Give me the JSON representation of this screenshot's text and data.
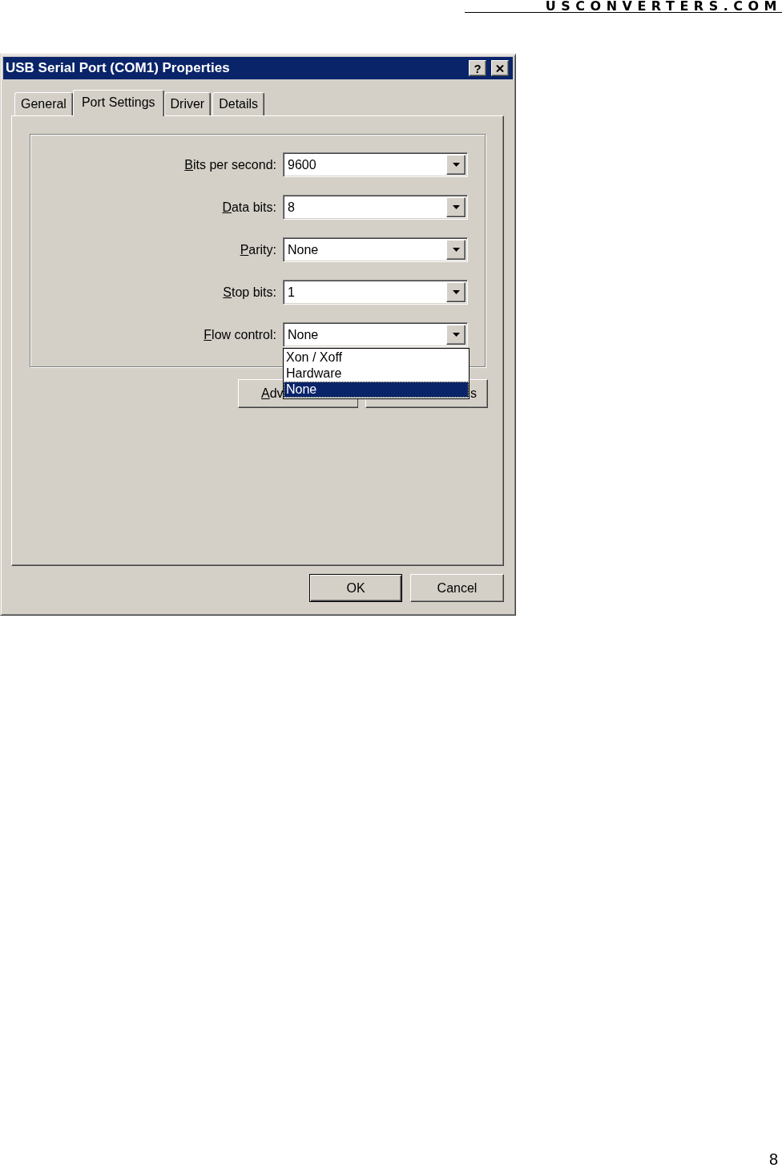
{
  "page_header": {
    "logo": "USCONVERTERS.COM"
  },
  "window": {
    "title": "USB Serial Port (COM1) Properties",
    "title_buttons": [
      {
        "kind": "help",
        "label": "?"
      },
      {
        "kind": "close"
      }
    ]
  },
  "tabs": [
    {
      "label": "General",
      "selected": false
    },
    {
      "label": "Port Settings",
      "selected": true
    },
    {
      "label": "Driver",
      "selected": false
    },
    {
      "label": "Details",
      "selected": false
    }
  ],
  "settings": [
    {
      "label": "Bits per second:",
      "value": "9600"
    },
    {
      "label": "Data bits:",
      "value": "8"
    },
    {
      "label": "Parity:",
      "value": "None"
    },
    {
      "label": "Stop bits:",
      "value": "1"
    },
    {
      "label": "Flow control:",
      "value": "None",
      "options": [
        {
          "label": "Xon / Xoff",
          "selected": false
        },
        {
          "label": "Hardware",
          "selected": false
        },
        {
          "label": "None",
          "selected": true
        }
      ]
    }
  ],
  "panel_buttons": [
    {
      "label": "Adv",
      "kind": "head"
    },
    {
      "label": "s",
      "kind": "tail"
    }
  ],
  "dialog_buttons": [
    {
      "label": "OK",
      "default": true
    },
    {
      "label": "Cancel",
      "default": false
    }
  ],
  "page_number": "8"
}
